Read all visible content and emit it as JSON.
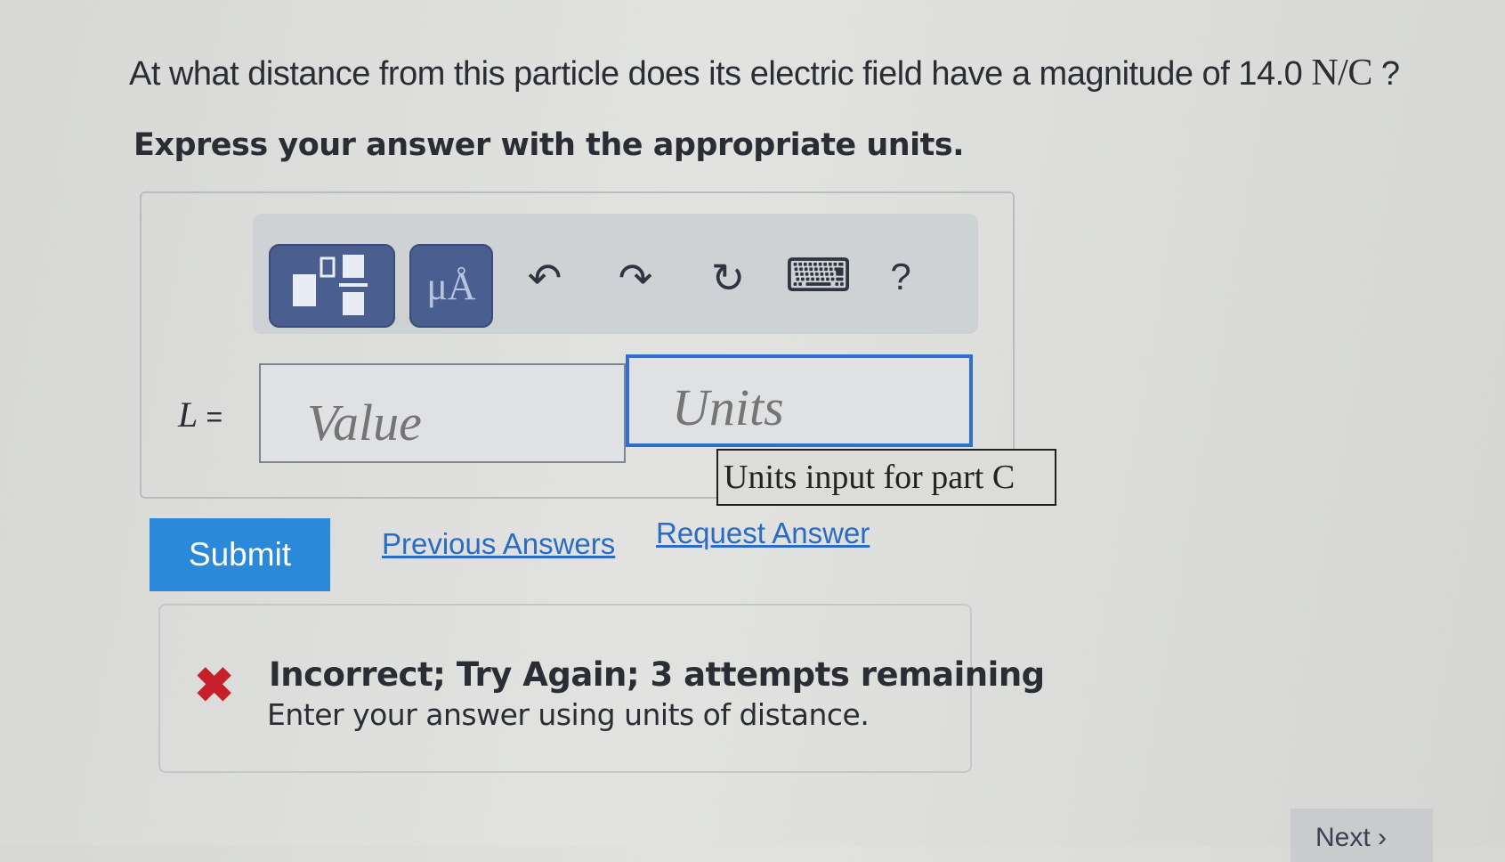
{
  "question": {
    "text": "At what distance from this particle does its electric field have a magnitude of 14.0",
    "unit": "N/C",
    "end": "?"
  },
  "instruction": "Express your answer with the appropriate units.",
  "toolbar": {
    "units_label": "μÅ",
    "undo_icon": "↶",
    "redo_icon": "↷",
    "reset_icon": "↻",
    "keyboard_icon": "⌨",
    "help_label": "?"
  },
  "answer": {
    "variable": "L",
    "equals": "=",
    "value_placeholder": "Value",
    "units_placeholder": "Units",
    "units_tooltip": "Units input for part C"
  },
  "actions": {
    "submit": "Submit",
    "previous_answers": "Previous Answers",
    "request_answer": "Request Answer"
  },
  "feedback": {
    "icon": "✖",
    "title": "Incorrect; Try Again; 3 attempts remaining",
    "message": "Enter your answer using units of distance."
  },
  "navigation": {
    "next": "Next ›"
  },
  "colors": {
    "submit_bg": "#2a8ad9",
    "link": "#2a6cc4",
    "error": "#c8202a",
    "toolbar_button": "#4a5f8f",
    "focus_border": "#2f6fd0"
  }
}
